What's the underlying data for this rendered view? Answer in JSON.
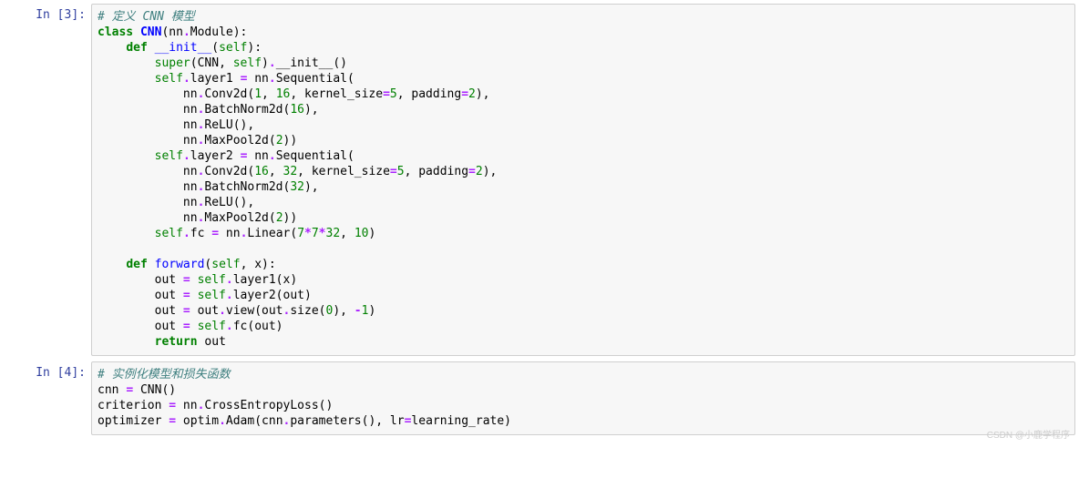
{
  "watermark": "CSDN @小鹿学程序",
  "cells": [
    {
      "prompt": "In [3]:",
      "tokens": [
        {
          "t": "# 定义 CNN 模型",
          "c": "c-comment"
        },
        {
          "t": "\n"
        },
        {
          "t": "class",
          "c": "c-keyword"
        },
        {
          "t": " "
        },
        {
          "t": "CNN",
          "c": "c-class"
        },
        {
          "t": "(nn"
        },
        {
          "t": ".",
          "c": "c-op"
        },
        {
          "t": "Module):"
        },
        {
          "t": "\n"
        },
        {
          "t": "    "
        },
        {
          "t": "def",
          "c": "c-keyword"
        },
        {
          "t": " "
        },
        {
          "t": "__init__",
          "c": "c-func"
        },
        {
          "t": "("
        },
        {
          "t": "self",
          "c": "c-self"
        },
        {
          "t": "):"
        },
        {
          "t": "\n"
        },
        {
          "t": "        "
        },
        {
          "t": "super",
          "c": "c-builtin"
        },
        {
          "t": "(CNN, "
        },
        {
          "t": "self",
          "c": "c-self"
        },
        {
          "t": ")"
        },
        {
          "t": ".",
          "c": "c-op"
        },
        {
          "t": "__init__()"
        },
        {
          "t": "\n"
        },
        {
          "t": "        "
        },
        {
          "t": "self",
          "c": "c-self"
        },
        {
          "t": ".",
          "c": "c-op"
        },
        {
          "t": "layer1 "
        },
        {
          "t": "=",
          "c": "c-op"
        },
        {
          "t": " nn"
        },
        {
          "t": ".",
          "c": "c-op"
        },
        {
          "t": "Sequential("
        },
        {
          "t": "\n"
        },
        {
          "t": "            nn"
        },
        {
          "t": ".",
          "c": "c-op"
        },
        {
          "t": "Conv2d("
        },
        {
          "t": "1",
          "c": "c-num"
        },
        {
          "t": ", "
        },
        {
          "t": "16",
          "c": "c-num"
        },
        {
          "t": ", kernel_size"
        },
        {
          "t": "=",
          "c": "c-op"
        },
        {
          "t": "5",
          "c": "c-num"
        },
        {
          "t": ", padding"
        },
        {
          "t": "=",
          "c": "c-op"
        },
        {
          "t": "2",
          "c": "c-num"
        },
        {
          "t": "),"
        },
        {
          "t": "\n"
        },
        {
          "t": "            nn"
        },
        {
          "t": ".",
          "c": "c-op"
        },
        {
          "t": "BatchNorm2d("
        },
        {
          "t": "16",
          "c": "c-num"
        },
        {
          "t": "),"
        },
        {
          "t": "\n"
        },
        {
          "t": "            nn"
        },
        {
          "t": ".",
          "c": "c-op"
        },
        {
          "t": "ReLU(),"
        },
        {
          "t": "\n"
        },
        {
          "t": "            nn"
        },
        {
          "t": ".",
          "c": "c-op"
        },
        {
          "t": "MaxPool2d("
        },
        {
          "t": "2",
          "c": "c-num"
        },
        {
          "t": "))"
        },
        {
          "t": "\n"
        },
        {
          "t": "        "
        },
        {
          "t": "self",
          "c": "c-self"
        },
        {
          "t": ".",
          "c": "c-op"
        },
        {
          "t": "layer2 "
        },
        {
          "t": "=",
          "c": "c-op"
        },
        {
          "t": " nn"
        },
        {
          "t": ".",
          "c": "c-op"
        },
        {
          "t": "Sequential("
        },
        {
          "t": "\n"
        },
        {
          "t": "            nn"
        },
        {
          "t": ".",
          "c": "c-op"
        },
        {
          "t": "Conv2d("
        },
        {
          "t": "16",
          "c": "c-num"
        },
        {
          "t": ", "
        },
        {
          "t": "32",
          "c": "c-num"
        },
        {
          "t": ", kernel_size"
        },
        {
          "t": "=",
          "c": "c-op"
        },
        {
          "t": "5",
          "c": "c-num"
        },
        {
          "t": ", padding"
        },
        {
          "t": "=",
          "c": "c-op"
        },
        {
          "t": "2",
          "c": "c-num"
        },
        {
          "t": "),"
        },
        {
          "t": "\n"
        },
        {
          "t": "            nn"
        },
        {
          "t": ".",
          "c": "c-op"
        },
        {
          "t": "BatchNorm2d("
        },
        {
          "t": "32",
          "c": "c-num"
        },
        {
          "t": "),"
        },
        {
          "t": "\n"
        },
        {
          "t": "            nn"
        },
        {
          "t": ".",
          "c": "c-op"
        },
        {
          "t": "ReLU(),"
        },
        {
          "t": "\n"
        },
        {
          "t": "            nn"
        },
        {
          "t": ".",
          "c": "c-op"
        },
        {
          "t": "MaxPool2d("
        },
        {
          "t": "2",
          "c": "c-num"
        },
        {
          "t": "))"
        },
        {
          "t": "\n"
        },
        {
          "t": "        "
        },
        {
          "t": "self",
          "c": "c-self"
        },
        {
          "t": ".",
          "c": "c-op"
        },
        {
          "t": "fc "
        },
        {
          "t": "=",
          "c": "c-op"
        },
        {
          "t": " nn"
        },
        {
          "t": ".",
          "c": "c-op"
        },
        {
          "t": "Linear("
        },
        {
          "t": "7",
          "c": "c-num"
        },
        {
          "t": "*",
          "c": "c-op"
        },
        {
          "t": "7",
          "c": "c-num"
        },
        {
          "t": "*",
          "c": "c-op"
        },
        {
          "t": "32",
          "c": "c-num"
        },
        {
          "t": ", "
        },
        {
          "t": "10",
          "c": "c-num"
        },
        {
          "t": ")"
        },
        {
          "t": "\n"
        },
        {
          "t": "\n"
        },
        {
          "t": "    "
        },
        {
          "t": "def",
          "c": "c-keyword"
        },
        {
          "t": " "
        },
        {
          "t": "forward",
          "c": "c-func"
        },
        {
          "t": "("
        },
        {
          "t": "self",
          "c": "c-self"
        },
        {
          "t": ", x):"
        },
        {
          "t": "\n"
        },
        {
          "t": "        out "
        },
        {
          "t": "=",
          "c": "c-op"
        },
        {
          "t": " "
        },
        {
          "t": "self",
          "c": "c-self"
        },
        {
          "t": ".",
          "c": "c-op"
        },
        {
          "t": "layer1(x)"
        },
        {
          "t": "\n"
        },
        {
          "t": "        out "
        },
        {
          "t": "=",
          "c": "c-op"
        },
        {
          "t": " "
        },
        {
          "t": "self",
          "c": "c-self"
        },
        {
          "t": ".",
          "c": "c-op"
        },
        {
          "t": "layer2(out)"
        },
        {
          "t": "\n"
        },
        {
          "t": "        out "
        },
        {
          "t": "=",
          "c": "c-op"
        },
        {
          "t": " out"
        },
        {
          "t": ".",
          "c": "c-op"
        },
        {
          "t": "view(out"
        },
        {
          "t": ".",
          "c": "c-op"
        },
        {
          "t": "size("
        },
        {
          "t": "0",
          "c": "c-num"
        },
        {
          "t": "), "
        },
        {
          "t": "-",
          "c": "c-op"
        },
        {
          "t": "1",
          "c": "c-num"
        },
        {
          "t": ")"
        },
        {
          "t": "\n"
        },
        {
          "t": "        out "
        },
        {
          "t": "=",
          "c": "c-op"
        },
        {
          "t": " "
        },
        {
          "t": "self",
          "c": "c-self"
        },
        {
          "t": ".",
          "c": "c-op"
        },
        {
          "t": "fc(out)"
        },
        {
          "t": "\n"
        },
        {
          "t": "        "
        },
        {
          "t": "return",
          "c": "c-keyword"
        },
        {
          "t": " out"
        }
      ]
    },
    {
      "prompt": "In [4]:",
      "tokens": [
        {
          "t": "# 实例化模型和损失函数",
          "c": "c-comment"
        },
        {
          "t": "\n"
        },
        {
          "t": "cnn "
        },
        {
          "t": "=",
          "c": "c-op"
        },
        {
          "t": " CNN()"
        },
        {
          "t": "\n"
        },
        {
          "t": "criterion "
        },
        {
          "t": "=",
          "c": "c-op"
        },
        {
          "t": " nn"
        },
        {
          "t": ".",
          "c": "c-op"
        },
        {
          "t": "CrossEntropyLoss()"
        },
        {
          "t": "\n"
        },
        {
          "t": "optimizer "
        },
        {
          "t": "=",
          "c": "c-op"
        },
        {
          "t": " optim"
        },
        {
          "t": ".",
          "c": "c-op"
        },
        {
          "t": "Adam(cnn"
        },
        {
          "t": ".",
          "c": "c-op"
        },
        {
          "t": "parameters(), lr"
        },
        {
          "t": "=",
          "c": "c-op"
        },
        {
          "t": "learning_rate)"
        }
      ]
    }
  ]
}
